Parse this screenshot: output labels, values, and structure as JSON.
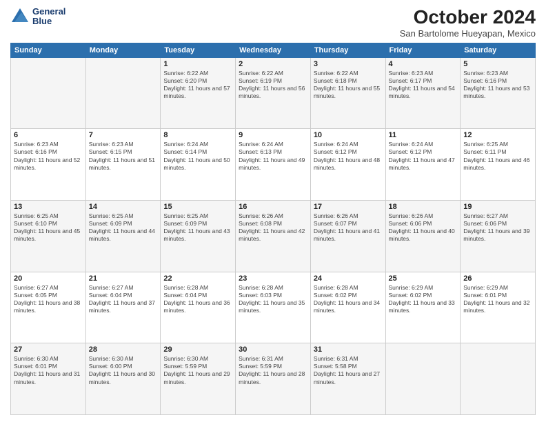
{
  "header": {
    "logo_line1": "General",
    "logo_line2": "Blue",
    "month": "October 2024",
    "location": "San Bartolome Hueyapan, Mexico"
  },
  "days_of_week": [
    "Sunday",
    "Monday",
    "Tuesday",
    "Wednesday",
    "Thursday",
    "Friday",
    "Saturday"
  ],
  "weeks": [
    [
      {
        "day": "",
        "info": ""
      },
      {
        "day": "",
        "info": ""
      },
      {
        "day": "1",
        "info": "Sunrise: 6:22 AM\nSunset: 6:20 PM\nDaylight: 11 hours and 57 minutes."
      },
      {
        "day": "2",
        "info": "Sunrise: 6:22 AM\nSunset: 6:19 PM\nDaylight: 11 hours and 56 minutes."
      },
      {
        "day": "3",
        "info": "Sunrise: 6:22 AM\nSunset: 6:18 PM\nDaylight: 11 hours and 55 minutes."
      },
      {
        "day": "4",
        "info": "Sunrise: 6:23 AM\nSunset: 6:17 PM\nDaylight: 11 hours and 54 minutes."
      },
      {
        "day": "5",
        "info": "Sunrise: 6:23 AM\nSunset: 6:16 PM\nDaylight: 11 hours and 53 minutes."
      }
    ],
    [
      {
        "day": "6",
        "info": "Sunrise: 6:23 AM\nSunset: 6:16 PM\nDaylight: 11 hours and 52 minutes."
      },
      {
        "day": "7",
        "info": "Sunrise: 6:23 AM\nSunset: 6:15 PM\nDaylight: 11 hours and 51 minutes."
      },
      {
        "day": "8",
        "info": "Sunrise: 6:24 AM\nSunset: 6:14 PM\nDaylight: 11 hours and 50 minutes."
      },
      {
        "day": "9",
        "info": "Sunrise: 6:24 AM\nSunset: 6:13 PM\nDaylight: 11 hours and 49 minutes."
      },
      {
        "day": "10",
        "info": "Sunrise: 6:24 AM\nSunset: 6:12 PM\nDaylight: 11 hours and 48 minutes."
      },
      {
        "day": "11",
        "info": "Sunrise: 6:24 AM\nSunset: 6:12 PM\nDaylight: 11 hours and 47 minutes."
      },
      {
        "day": "12",
        "info": "Sunrise: 6:25 AM\nSunset: 6:11 PM\nDaylight: 11 hours and 46 minutes."
      }
    ],
    [
      {
        "day": "13",
        "info": "Sunrise: 6:25 AM\nSunset: 6:10 PM\nDaylight: 11 hours and 45 minutes."
      },
      {
        "day": "14",
        "info": "Sunrise: 6:25 AM\nSunset: 6:09 PM\nDaylight: 11 hours and 44 minutes."
      },
      {
        "day": "15",
        "info": "Sunrise: 6:25 AM\nSunset: 6:09 PM\nDaylight: 11 hours and 43 minutes."
      },
      {
        "day": "16",
        "info": "Sunrise: 6:26 AM\nSunset: 6:08 PM\nDaylight: 11 hours and 42 minutes."
      },
      {
        "day": "17",
        "info": "Sunrise: 6:26 AM\nSunset: 6:07 PM\nDaylight: 11 hours and 41 minutes."
      },
      {
        "day": "18",
        "info": "Sunrise: 6:26 AM\nSunset: 6:06 PM\nDaylight: 11 hours and 40 minutes."
      },
      {
        "day": "19",
        "info": "Sunrise: 6:27 AM\nSunset: 6:06 PM\nDaylight: 11 hours and 39 minutes."
      }
    ],
    [
      {
        "day": "20",
        "info": "Sunrise: 6:27 AM\nSunset: 6:05 PM\nDaylight: 11 hours and 38 minutes."
      },
      {
        "day": "21",
        "info": "Sunrise: 6:27 AM\nSunset: 6:04 PM\nDaylight: 11 hours and 37 minutes."
      },
      {
        "day": "22",
        "info": "Sunrise: 6:28 AM\nSunset: 6:04 PM\nDaylight: 11 hours and 36 minutes."
      },
      {
        "day": "23",
        "info": "Sunrise: 6:28 AM\nSunset: 6:03 PM\nDaylight: 11 hours and 35 minutes."
      },
      {
        "day": "24",
        "info": "Sunrise: 6:28 AM\nSunset: 6:02 PM\nDaylight: 11 hours and 34 minutes."
      },
      {
        "day": "25",
        "info": "Sunrise: 6:29 AM\nSunset: 6:02 PM\nDaylight: 11 hours and 33 minutes."
      },
      {
        "day": "26",
        "info": "Sunrise: 6:29 AM\nSunset: 6:01 PM\nDaylight: 11 hours and 32 minutes."
      }
    ],
    [
      {
        "day": "27",
        "info": "Sunrise: 6:30 AM\nSunset: 6:01 PM\nDaylight: 11 hours and 31 minutes."
      },
      {
        "day": "28",
        "info": "Sunrise: 6:30 AM\nSunset: 6:00 PM\nDaylight: 11 hours and 30 minutes."
      },
      {
        "day": "29",
        "info": "Sunrise: 6:30 AM\nSunset: 5:59 PM\nDaylight: 11 hours and 29 minutes."
      },
      {
        "day": "30",
        "info": "Sunrise: 6:31 AM\nSunset: 5:59 PM\nDaylight: 11 hours and 28 minutes."
      },
      {
        "day": "31",
        "info": "Sunrise: 6:31 AM\nSunset: 5:58 PM\nDaylight: 11 hours and 27 minutes."
      },
      {
        "day": "",
        "info": ""
      },
      {
        "day": "",
        "info": ""
      }
    ]
  ]
}
